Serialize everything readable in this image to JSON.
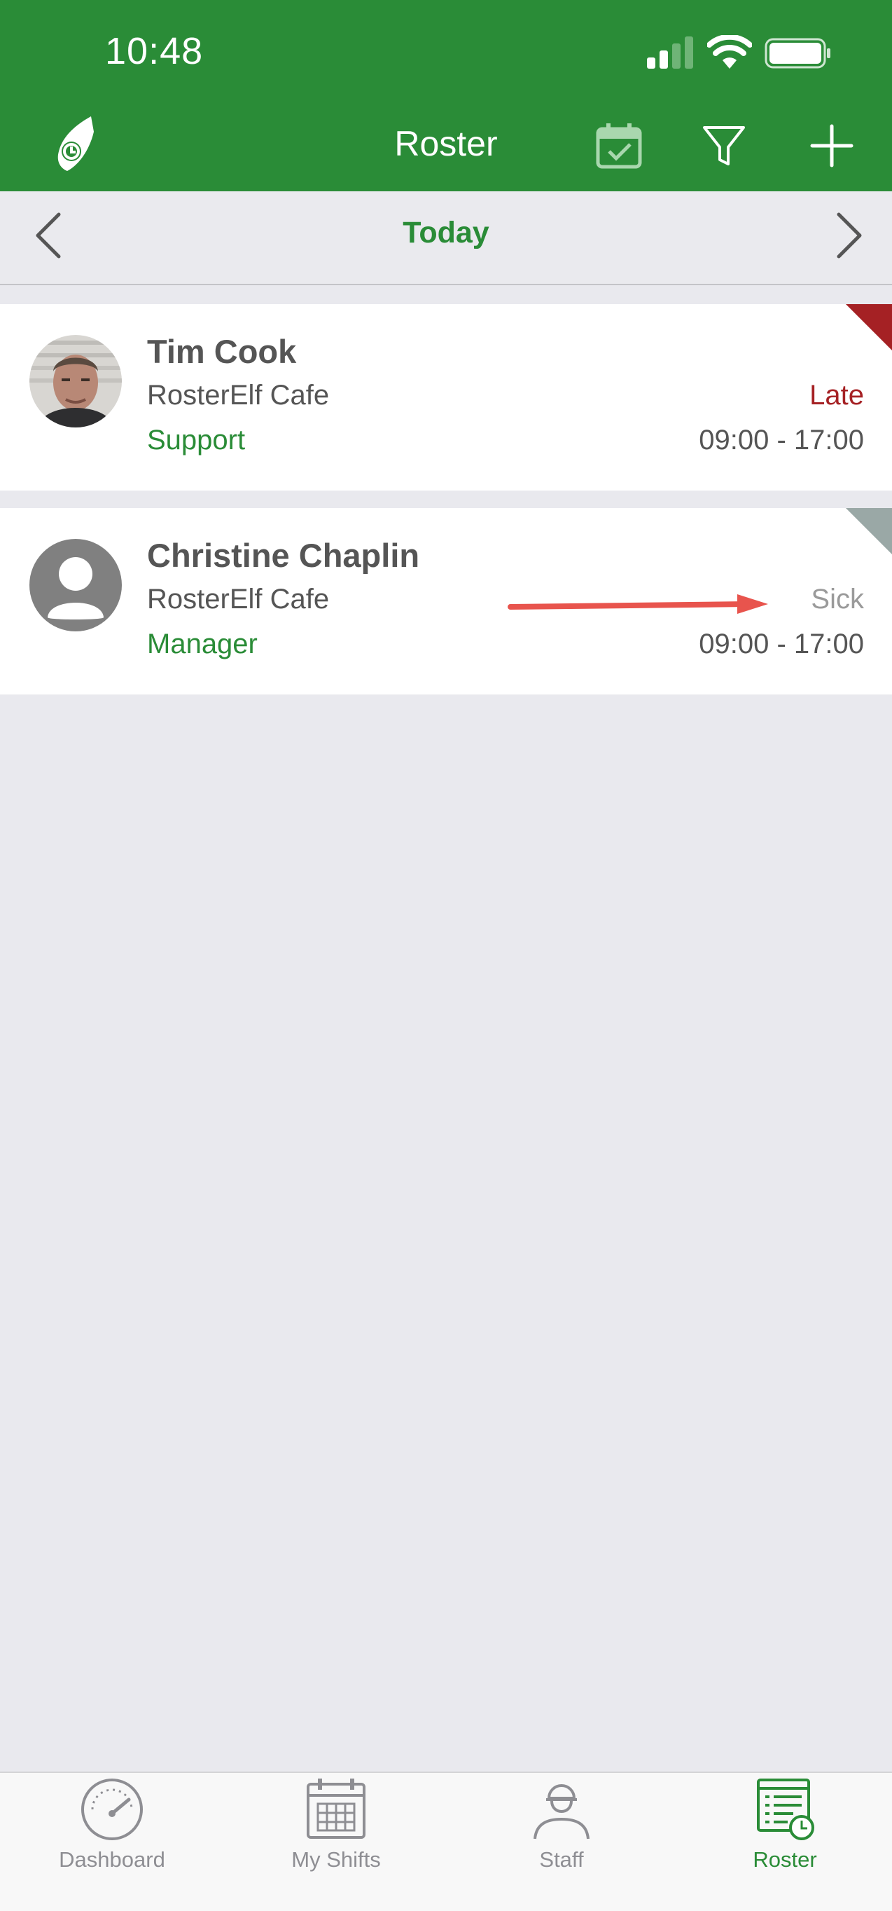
{
  "status_bar": {
    "time": "10:48"
  },
  "nav": {
    "title": "Roster"
  },
  "day_nav": {
    "label": "Today"
  },
  "colors": {
    "brand_green": "#2A8C37",
    "late_red": "#A52124",
    "sick_gray": "#9AA8A6"
  },
  "roster": [
    {
      "name": "Tim Cook",
      "location": "RosterElf Cafe",
      "role": "Support",
      "status": "Late",
      "time": "09:00 - 17:00"
    },
    {
      "name": "Christine Chaplin",
      "location": "RosterElf Cafe",
      "role": "Manager",
      "status": "Sick",
      "time": "09:00 - 17:00"
    }
  ],
  "tabbar": {
    "items": [
      {
        "label": "Dashboard",
        "icon": "dashboard-gauge-icon"
      },
      {
        "label": "My Shifts",
        "icon": "calendar-grid-icon"
      },
      {
        "label": "Staff",
        "icon": "worker-helmet-icon"
      },
      {
        "label": "Roster",
        "icon": "roster-list-clock-icon",
        "active": true
      }
    ]
  }
}
